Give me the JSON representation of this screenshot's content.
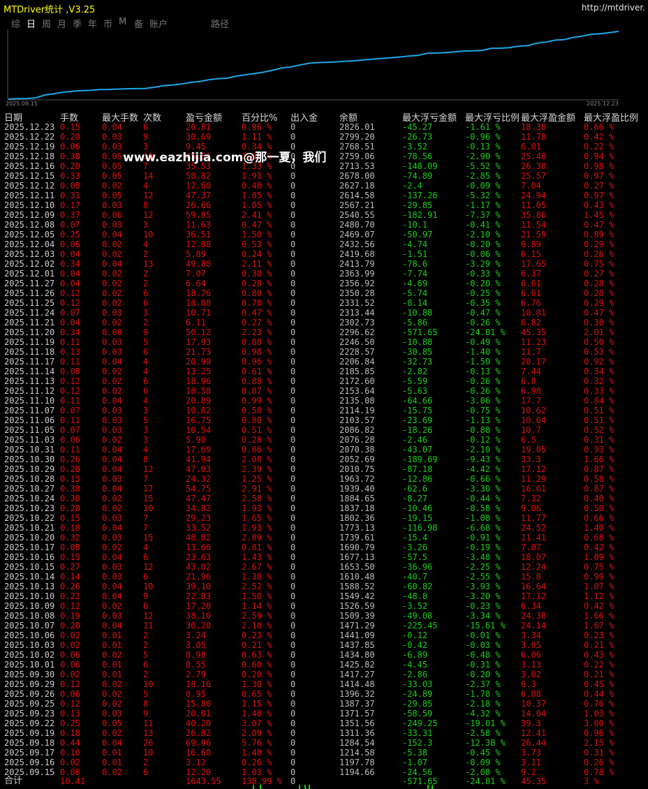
{
  "title": "MTDriver统计 ,V3.25",
  "url": "http://mtdriver.",
  "tabs": [
    "综",
    "日",
    "周",
    "月",
    "季",
    "年",
    "币",
    "M",
    "备",
    "账户",
    "路径"
  ],
  "active_tab": 1,
  "chart_labels": {
    "start": "2025.09.15",
    "end": "2025.12.23"
  },
  "watermark": "www.eazhijia.com@那一夏，我们",
  "colors": {
    "equity_line": "#1ea6e6",
    "profit": "#e01010",
    "loss": "#18d018"
  },
  "columns": [
    "日期",
    "手数",
    "最大手数",
    "次数",
    "盈亏金额",
    "百分比%",
    "出入金",
    "余额",
    "最大浮亏金额",
    "最大浮亏比例",
    "最大浮盈金额",
    "最大浮盈比例"
  ],
  "rows": [
    [
      "2025.12.23",
      "0.15",
      "0.04",
      "6",
      "26.81",
      "0.96 %",
      "0",
      "2826.01",
      "-45.27",
      "-1.61 %",
      "18.38",
      "0.66 %"
    ],
    [
      "2025.12.22",
      "0.20",
      "0.03",
      "9",
      "30.69",
      "1.11 %",
      "0",
      "2799.20",
      "-26.73",
      "-0.96 %",
      "11.78",
      "0.42 %"
    ],
    [
      "2025.12.19",
      "0.06",
      "0.03",
      "3",
      "9.45",
      "0.34 %",
      "0",
      "2768.51",
      "-3.52",
      "-0.13 %",
      "6.01",
      "0.22 %"
    ],
    [
      "2025.12.18",
      "0.30",
      "0.05",
      "10",
      "45.51",
      "1.68 %",
      "0",
      "2759.06",
      "-78.56",
      "-2.90 %",
      "25.48",
      "0.94 %"
    ],
    [
      "2025.12.16",
      "0.20",
      "0.05",
      "7",
      "35.53",
      "1.33 %",
      "0",
      "2713.53",
      "-148.09",
      "-5.52 %",
      "26.38",
      "0.98 %"
    ],
    [
      "2025.12.15",
      "0.33",
      "0.05",
      "14",
      "50.82",
      "1.93 %",
      "0",
      "2678.00",
      "-74.89",
      "-2.85 %",
      "25.57",
      "0.97 %"
    ],
    [
      "2025.12.12",
      "0.08",
      "0.02",
      "4",
      "12.60",
      "0.48 %",
      "0",
      "2627.18",
      "-2.4",
      "-0.09 %",
      "7.04",
      "0.27 %"
    ],
    [
      "2025.12.11",
      "0.31",
      "0.05",
      "12",
      "47.37",
      "1.85 %",
      "0",
      "2614.58",
      "-137.26",
      "-5.32 %",
      "24.94",
      "0.97 %"
    ],
    [
      "2025.12.10",
      "0.17",
      "0.03",
      "8",
      "26.66",
      "1.05 %",
      "0",
      "2567.21",
      "-29.85",
      "-1.17 %",
      "11.05",
      "0.43 %"
    ],
    [
      "2025.12.09",
      "0.37",
      "0.06",
      "12",
      "59.85",
      "2.41 %",
      "0",
      "2540.55",
      "-182.91",
      "-7.37 %",
      "35.86",
      "1.45 %"
    ],
    [
      "2025.12.08",
      "0.07",
      "0.03",
      "3",
      "11.63",
      "0.47 %",
      "0",
      "2480.70",
      "-10.1",
      "-0.41 %",
      "11.54",
      "0.47 %"
    ],
    [
      "2025.12.05",
      "0.25",
      "0.04",
      "10",
      "36.51",
      "1.50 %",
      "0",
      "2469.07",
      "-50.97",
      "-2.10 %",
      "21.59",
      "0.89 %"
    ],
    [
      "2025.12.04",
      "0.06",
      "0.02",
      "4",
      "12.88",
      "0.53 %",
      "0",
      "2432.56",
      "-4.74",
      "-0.20 %",
      "6.89",
      "0.29 %"
    ],
    [
      "2025.12.03",
      "0.04",
      "0.02",
      "2",
      "5.89",
      "0.24 %",
      "0",
      "2419.68",
      "-1.51",
      "-0.06 %",
      "6.15",
      "0.26 %"
    ],
    [
      "2025.12.02",
      "0.34",
      "0.04",
      "13",
      "49.80",
      "2.11 %",
      "0",
      "2413.79",
      "-78.6",
      "-3.29 %",
      "17.65",
      "0.75 %"
    ],
    [
      "2025.12.01",
      "0.04",
      "0.02",
      "2",
      "7.07",
      "0.30 %",
      "0",
      "2363.99",
      "-7.74",
      "-0.33 %",
      "6.37",
      "0.27 %"
    ],
    [
      "2025.11.27",
      "0.04",
      "0.02",
      "2",
      "6.64",
      "0.28 %",
      "0",
      "2356.92",
      "-4.69",
      "-0.20 %",
      "6.61",
      "0.28 %"
    ],
    [
      "2025.11.26",
      "0.12",
      "0.02",
      "6",
      "18.76",
      "0.80 %",
      "0",
      "2350.28",
      "-5.74",
      "-0.25 %",
      "6.61",
      "0.28 %"
    ],
    [
      "2025.11.25",
      "0.12",
      "0.02",
      "6",
      "18.08",
      "0.78 %",
      "0",
      "2331.52",
      "-8.14",
      "-0.35 %",
      "6.76",
      "0.29 %"
    ],
    [
      "2025.11.24",
      "0.07",
      "0.03",
      "3",
      "10.71",
      "0.47 %",
      "0",
      "2313.44",
      "-10.88",
      "-0.47 %",
      "10.81",
      "0.47 %"
    ],
    [
      "2025.11.21",
      "0.04",
      "0.02",
      "2",
      "6.11",
      "0.27 %",
      "0",
      "2302.73",
      "-5.86",
      "-0.26 %",
      "6.82",
      "0.30 %"
    ],
    [
      "2025.11.20",
      "0.34",
      "0.08",
      "9",
      "50.12",
      "2.23 %",
      "0",
      "2296.62",
      "-571.65",
      "-24.81 %",
      "45.35",
      "2.01 %"
    ],
    [
      "2025.11.19",
      "0.11",
      "0.03",
      "5",
      "17.93",
      "0.80 %",
      "0",
      "2246.50",
      "-10.88",
      "-0.49 %",
      "11.23",
      "0.50 %"
    ],
    [
      "2025.11.18",
      "0.13",
      "0.03",
      "6",
      "21.73",
      "0.98 %",
      "0",
      "2228.57",
      "-30.85",
      "-1.40 %",
      "11.7",
      "0.53 %"
    ],
    [
      "2025.11.17",
      "0.11",
      "0.04",
      "4",
      "20.99",
      "0.96 %",
      "0",
      "2206.84",
      "-32.73",
      "-1.50 %",
      "20.17",
      "0.92 %"
    ],
    [
      "2025.11.14",
      "0.08",
      "0.02",
      "4",
      "13.25",
      "0.61 %",
      "0",
      "2185.85",
      "-2.82",
      "-0.13 %",
      "7.44",
      "0.34 %"
    ],
    [
      "2025.11.13",
      "0.12",
      "0.02",
      "6",
      "18.96",
      "0.88 %",
      "0",
      "2172.60",
      "-5.59",
      "-0.26 %",
      "6.8",
      "0.32 %"
    ],
    [
      "2025.11.12",
      "0.12",
      "0.02",
      "6",
      "18.58",
      "0.87 %",
      "0",
      "2153.64",
      "-5.63",
      "-0.26 %",
      "6.98",
      "0.33 %"
    ],
    [
      "2025.11.10",
      "0.11",
      "0.04",
      "4",
      "20.89",
      "0.99 %",
      "0",
      "2135.08",
      "-64.66",
      "-3.06 %",
      "17.7",
      "0.84 %"
    ],
    [
      "2025.11.07",
      "0.07",
      "0.03",
      "3",
      "10.62",
      "0.50 %",
      "0",
      "2114.19",
      "-15.75",
      "-0.75 %",
      "10.62",
      "0.51 %"
    ],
    [
      "2025.11.06",
      "0.11",
      "0.03",
      "5",
      "16.75",
      "0.80 %",
      "0",
      "2103.57",
      "-23.69",
      "-1.13 %",
      "10.64",
      "0.51 %"
    ],
    [
      "2025.11.05",
      "0.07",
      "0.03",
      "3",
      "10.54",
      "0.51 %",
      "0",
      "2086.82",
      "-18.26",
      "-0.88 %",
      "10.7",
      "0.52 %"
    ],
    [
      "2025.11.03",
      "0.06",
      "0.02",
      "3",
      "5.90",
      "0.28 %",
      "0",
      "2076.28",
      "-2.46",
      "-0.12 %",
      "6.5",
      "0.31 %"
    ],
    [
      "2025.10.31",
      "0.11",
      "0.04",
      "4",
      "17.69",
      "0.86 %",
      "0",
      "2070.38",
      "-43.07",
      "-2.10 %",
      "19.05",
      "0.93 %"
    ],
    [
      "2025.10.30",
      "0.26",
      "0.04",
      "8",
      "41.94",
      "2.08 %",
      "0",
      "2052.69",
      "-189.69",
      "-9.43 %",
      "33.3",
      "1.66 %"
    ],
    [
      "2025.10.29",
      "0.28",
      "0.04",
      "12",
      "47.03",
      "2.39 %",
      "0",
      "2010.75",
      "-87.18",
      "-4.42 %",
      "17.12",
      "0.87 %"
    ],
    [
      "2025.10.28",
      "0.15",
      "0.03",
      "7",
      "24.32",
      "1.25 %",
      "0",
      "1963.72",
      "-12.86",
      "-0.66 %",
      "11.29",
      "0.58 %"
    ],
    [
      "2025.10.27",
      "0.38",
      "0.04",
      "17",
      "54.75",
      "2.91 %",
      "0",
      "1939.40",
      "-62.6",
      "-3.30 %",
      "16.61",
      "0.87 %"
    ],
    [
      "2025.10.24",
      "0.30",
      "0.02",
      "15",
      "47.47",
      "2.58 %",
      "0",
      "1884.65",
      "-8.27",
      "-0.44 %",
      "7.32",
      "0.40 %"
    ],
    [
      "2025.10.23",
      "0.20",
      "0.02",
      "10",
      "34.82",
      "1.93 %",
      "0",
      "1837.18",
      "-10.46",
      "-0.58 %",
      "9.06",
      "0.50 %"
    ],
    [
      "2025.10.22",
      "0.15",
      "0.03",
      "7",
      "29.23",
      "1.65 %",
      "0",
      "1802.36",
      "-19.15",
      "-1.08 %",
      "11.77",
      "0.66 %"
    ],
    [
      "2025.10.21",
      "0.18",
      "0.04",
      "7",
      "33.52",
      "1.93 %",
      "0",
      "1773.13",
      "-116.98",
      "-6.68 %",
      "24.52",
      "1.40 %"
    ],
    [
      "2025.10.20",
      "0.32",
      "0.03",
      "15",
      "48.82",
      "2.89 %",
      "0",
      "1739.61",
      "-15.4",
      "-0.91 %",
      "11.41",
      "0.68 %"
    ],
    [
      "2025.10.17",
      "0.08",
      "0.02",
      "4",
      "13.66",
      "0.81 %",
      "0",
      "1690.79",
      "-3.26",
      "-0.19 %",
      "7.07",
      "0.42 %"
    ],
    [
      "2025.10.16",
      "0.15",
      "0.04",
      "6",
      "23.63",
      "1.43 %",
      "0",
      "1677.13",
      "-57.5",
      "-3.48 %",
      "18.07",
      "1.09 %"
    ],
    [
      "2025.10.15",
      "0.27",
      "0.03",
      "12",
      "43.02",
      "2.67 %",
      "0",
      "1653.50",
      "-36.96",
      "-2.25 %",
      "12.24",
      "0.75 %"
    ],
    [
      "2025.10.14",
      "0.14",
      "0.03",
      "6",
      "21.96",
      "1.38 %",
      "0",
      "1610.48",
      "-40.7",
      "-2.55 %",
      "15.8",
      "0.99 %"
    ],
    [
      "2025.10.13",
      "0.26",
      "0.04",
      "10",
      "39.10",
      "2.52 %",
      "0",
      "1588.52",
      "-60.82",
      "-3.93 %",
      "16.64",
      "1.07 %"
    ],
    [
      "2025.10.10",
      "0.22",
      "0.04",
      "9",
      "22.83",
      "1.50 %",
      "0",
      "1549.42",
      "-48.8",
      "-3.20 %",
      "17.12",
      "1.12 %"
    ],
    [
      "2025.10.09",
      "0.12",
      "0.02",
      "6",
      "17.20",
      "1.14 %",
      "0",
      "1526.59",
      "-3.52",
      "-0.23 %",
      "6.34",
      "0.42 %"
    ],
    [
      "2025.10.08",
      "0.19",
      "0.03",
      "12",
      "38.10",
      "2.59 %",
      "0",
      "1509.39",
      "-49.08",
      "-3.34 %",
      "24.38",
      "1.66 %"
    ],
    [
      "2025.10.07",
      "0.20",
      "0.04",
      "11",
      "30.20",
      "2.10 %",
      "0",
      "1471.29",
      "-225.45",
      "-15.61 %",
      "24.14",
      "1.67 %"
    ],
    [
      "2025.10.06",
      "0.02",
      "0.01",
      "2",
      "3.24",
      "0.23 %",
      "0",
      "1441.09",
      "-0.12",
      "-0.01 %",
      "3.34",
      "0.23 %"
    ],
    [
      "2025.10.03",
      "0.02",
      "0.01",
      "2",
      "3.05",
      "0.21 %",
      "0",
      "1437.85",
      "-0.42",
      "-0.03 %",
      "3.05",
      "0.21 %"
    ],
    [
      "2025.10.02",
      "0.06",
      "0.02",
      "5",
      "8.98",
      "0.63 %",
      "0",
      "1434.80",
      "-6.89",
      "-0.48 %",
      "6.06",
      "0.43 %"
    ],
    [
      "2025.10.01",
      "0.06",
      "0.01",
      "6",
      "8.55",
      "0.60 %",
      "0",
      "1425.82",
      "-4.45",
      "-0.31 %",
      "3.13",
      "0.22 %"
    ],
    [
      "2025.09.30",
      "0.02",
      "0.01",
      "2",
      "2.79",
      "0.20 %",
      "0",
      "1417.27",
      "-2.86",
      "-0.20 %",
      "3.02",
      "0.21 %"
    ],
    [
      "2025.09.29",
      "0.12",
      "0.02",
      "10",
      "18.16",
      "1.30 %",
      "0",
      "1414.48",
      "-33.03",
      "-2.37 %",
      "6.3",
      "0.45 %"
    ],
    [
      "2025.09.26",
      "0.06",
      "0.02",
      "5",
      "8.95",
      "0.65 %",
      "0",
      "1396.32",
      "-24.89",
      "-1.78 %",
      "6.08",
      "0.44 %"
    ],
    [
      "2025.09.25",
      "0.12",
      "0.02",
      "8",
      "15.80",
      "1.15 %",
      "0",
      "1387.37",
      "-29.85",
      "-2.18 %",
      "10.37",
      "0.76 %"
    ],
    [
      "2025.09.23",
      "0.13",
      "0.03",
      "9",
      "20.01",
      "1.48 %",
      "0",
      "1371.57",
      "-58.59",
      "-4.32 %",
      "14.04",
      "1.03 %"
    ],
    [
      "2025.09.22",
      "0.25",
      "0.05",
      "11",
      "40.20",
      "3.07 %",
      "0",
      "1351.56",
      "-249.25",
      "-19.01 %",
      "39.3",
      "3.00 %"
    ],
    [
      "2025.09.19",
      "0.18",
      "0.02",
      "13",
      "26.82",
      "2.09 %",
      "0",
      "1311.36",
      "-33.31",
      "-2.58 %",
      "12.41",
      "0.96 %"
    ],
    [
      "2025.09.18",
      "0.44",
      "0.04",
      "26",
      "69.96",
      "5.76 %",
      "0",
      "1284.54",
      "-152.3",
      "-12.38 %",
      "26.44",
      "2.15 %"
    ],
    [
      "2025.09.17",
      "0.10",
      "0.01",
      "10",
      "16.60",
      "1.40 %",
      "0",
      "1214.58",
      "-5.38",
      "-0.45 %",
      "3.73",
      "0.31 %"
    ],
    [
      "2025.09.16",
      "0.02",
      "0.01",
      "2",
      "3.12",
      "0.26 %",
      "0",
      "1197.78",
      "-1.07",
      "-0.09 %",
      "3.11",
      "0.26 %"
    ],
    [
      "2025.09.15",
      "0.08",
      "0.02",
      "6",
      "12.20",
      "1.03 %",
      "0",
      "1194.66",
      "-24.56",
      "-2.08 %",
      "9.2",
      "0.78 %"
    ]
  ],
  "totals": [
    "合计",
    "10.41",
    "",
    "",
    "1643.55",
    "138.99 %",
    "0",
    "",
    "-571.65",
    "-24.81 %",
    "45.35",
    "3 %"
  ]
}
